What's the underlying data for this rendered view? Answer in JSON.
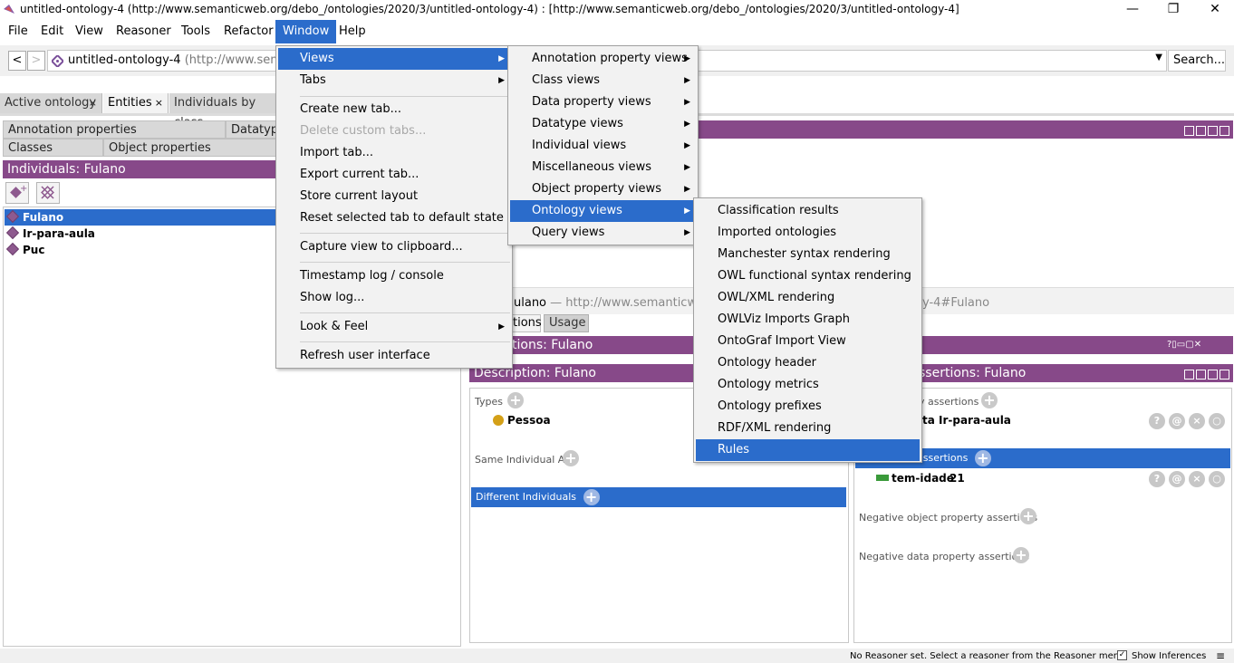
{
  "window": {
    "title": "untitled-ontology-4 (http://www.semanticweb.org/debo_/ontologies/2020/3/untitled-ontology-4)  : [http://www.semanticweb.org/debo_/ontologies/2020/3/untitled-ontology-4]",
    "minimize": "—",
    "restore": "❐",
    "close": "✕"
  },
  "menubar": [
    "File",
    "Edit",
    "View",
    "Reasoner",
    "Tools",
    "Refactor",
    "Window",
    "Help"
  ],
  "address": {
    "back": "<",
    "forward": ">",
    "ontology_name": "untitled-ontology-4",
    "ontology_iri_partial": "(http://www.semantic",
    "search_label": "Search..."
  },
  "tabs": [
    {
      "label": "Active ontology",
      "close": "×"
    },
    {
      "label": "Entities",
      "close": "×"
    },
    {
      "label": "Individuals by class",
      "close": ""
    }
  ],
  "left": {
    "subtabs_row1": [
      "Annotation properties",
      "Datatype"
    ],
    "subtabs_row2": [
      "Classes",
      "Object properties"
    ],
    "header": "Individuals: Fulano",
    "individuals": [
      "Fulano",
      "Ir-para-aula",
      "Puc"
    ]
  },
  "right": {
    "entity_line_name": "ulano",
    "entity_line_dash": "—",
    "entity_line_iri": "http://www.semanticweb.c",
    "entity_line_iri_end": "y-4#Fulano",
    "tabs": [
      "tions",
      "Usage"
    ],
    "annotations_header": "tions: Fulano",
    "description_header": "Description: Fulano",
    "property_header": "ssertions: Fulano",
    "types_label": "Types",
    "type_value": "Pessoa",
    "same_individual": "Same Individual As",
    "different_individuals": "Different Individuals",
    "obj_assert_label": "y assertions",
    "obj_assert_value_prop": "ta",
    "obj_assert_value": "Ir-para-aula",
    "data_assert_label": "assertions",
    "data_prop": "tem-idade",
    "data_value": "21",
    "neg_obj": "Negative object property assertions",
    "neg_data": "Negative data property assertions",
    "row_buttons": [
      "?",
      "@",
      "×",
      "○"
    ]
  },
  "window_menu": {
    "items": [
      {
        "label": "Views",
        "submenu": true
      },
      {
        "label": "Tabs",
        "submenu": true
      },
      {
        "label": "Create new tab..."
      },
      {
        "label": "Delete custom tabs..."
      },
      {
        "label": "Import tab..."
      },
      {
        "label": "Export current tab..."
      },
      {
        "label": "Store current layout"
      },
      {
        "label": "Reset selected tab to default state"
      },
      {
        "label": "Capture view to clipboard..."
      },
      {
        "label": "Timestamp log / console"
      },
      {
        "label": "Show log..."
      },
      {
        "label": "Look & Feel",
        "submenu": true
      },
      {
        "label": "Refresh user interface"
      }
    ]
  },
  "views_menu": {
    "items": [
      "Annotation property views",
      "Class views",
      "Data property views",
      "Datatype views",
      "Individual views",
      "Miscellaneous views",
      "Object property views",
      "Ontology views",
      "Query views"
    ]
  },
  "ontology_views_menu": {
    "items": [
      "Classification results",
      "Imported ontologies",
      "Manchester syntax rendering",
      "OWL functional syntax rendering",
      "OWL/XML rendering",
      "OWLViz Imports Graph",
      "OntoGraf Import View",
      "Ontology header",
      "Ontology metrics",
      "Ontology prefixes",
      "RDF/XML rendering",
      "Rules"
    ]
  },
  "status": {
    "reasoner": "No Reasoner set. Select a reasoner from the Reasoner menu",
    "show_inferences": "Show Inferences",
    "checkmark": "✓"
  },
  "colors": {
    "accent_blue": "#2b6ccb",
    "header_purple": "#874989",
    "type_dot": "#d4a017",
    "data_prop_green": "#3a9a3a"
  }
}
